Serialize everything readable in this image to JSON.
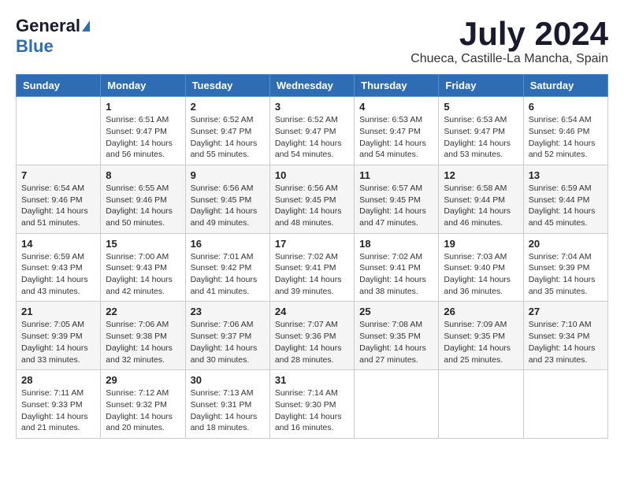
{
  "header": {
    "logo_general": "General",
    "logo_blue": "Blue",
    "month": "July 2024",
    "location": "Chueca, Castille-La Mancha, Spain"
  },
  "weekdays": [
    "Sunday",
    "Monday",
    "Tuesday",
    "Wednesday",
    "Thursday",
    "Friday",
    "Saturday"
  ],
  "weeks": [
    [
      {
        "day": "",
        "sunrise": "",
        "sunset": "",
        "daylight": ""
      },
      {
        "day": "1",
        "sunrise": "Sunrise: 6:51 AM",
        "sunset": "Sunset: 9:47 PM",
        "daylight": "Daylight: 14 hours and 56 minutes."
      },
      {
        "day": "2",
        "sunrise": "Sunrise: 6:52 AM",
        "sunset": "Sunset: 9:47 PM",
        "daylight": "Daylight: 14 hours and 55 minutes."
      },
      {
        "day": "3",
        "sunrise": "Sunrise: 6:52 AM",
        "sunset": "Sunset: 9:47 PM",
        "daylight": "Daylight: 14 hours and 54 minutes."
      },
      {
        "day": "4",
        "sunrise": "Sunrise: 6:53 AM",
        "sunset": "Sunset: 9:47 PM",
        "daylight": "Daylight: 14 hours and 54 minutes."
      },
      {
        "day": "5",
        "sunrise": "Sunrise: 6:53 AM",
        "sunset": "Sunset: 9:47 PM",
        "daylight": "Daylight: 14 hours and 53 minutes."
      },
      {
        "day": "6",
        "sunrise": "Sunrise: 6:54 AM",
        "sunset": "Sunset: 9:46 PM",
        "daylight": "Daylight: 14 hours and 52 minutes."
      }
    ],
    [
      {
        "day": "7",
        "sunrise": "Sunrise: 6:54 AM",
        "sunset": "Sunset: 9:46 PM",
        "daylight": "Daylight: 14 hours and 51 minutes."
      },
      {
        "day": "8",
        "sunrise": "Sunrise: 6:55 AM",
        "sunset": "Sunset: 9:46 PM",
        "daylight": "Daylight: 14 hours and 50 minutes."
      },
      {
        "day": "9",
        "sunrise": "Sunrise: 6:56 AM",
        "sunset": "Sunset: 9:45 PM",
        "daylight": "Daylight: 14 hours and 49 minutes."
      },
      {
        "day": "10",
        "sunrise": "Sunrise: 6:56 AM",
        "sunset": "Sunset: 9:45 PM",
        "daylight": "Daylight: 14 hours and 48 minutes."
      },
      {
        "day": "11",
        "sunrise": "Sunrise: 6:57 AM",
        "sunset": "Sunset: 9:45 PM",
        "daylight": "Daylight: 14 hours and 47 minutes."
      },
      {
        "day": "12",
        "sunrise": "Sunrise: 6:58 AM",
        "sunset": "Sunset: 9:44 PM",
        "daylight": "Daylight: 14 hours and 46 minutes."
      },
      {
        "day": "13",
        "sunrise": "Sunrise: 6:59 AM",
        "sunset": "Sunset: 9:44 PM",
        "daylight": "Daylight: 14 hours and 45 minutes."
      }
    ],
    [
      {
        "day": "14",
        "sunrise": "Sunrise: 6:59 AM",
        "sunset": "Sunset: 9:43 PM",
        "daylight": "Daylight: 14 hours and 43 minutes."
      },
      {
        "day": "15",
        "sunrise": "Sunrise: 7:00 AM",
        "sunset": "Sunset: 9:43 PM",
        "daylight": "Daylight: 14 hours and 42 minutes."
      },
      {
        "day": "16",
        "sunrise": "Sunrise: 7:01 AM",
        "sunset": "Sunset: 9:42 PM",
        "daylight": "Daylight: 14 hours and 41 minutes."
      },
      {
        "day": "17",
        "sunrise": "Sunrise: 7:02 AM",
        "sunset": "Sunset: 9:41 PM",
        "daylight": "Daylight: 14 hours and 39 minutes."
      },
      {
        "day": "18",
        "sunrise": "Sunrise: 7:02 AM",
        "sunset": "Sunset: 9:41 PM",
        "daylight": "Daylight: 14 hours and 38 minutes."
      },
      {
        "day": "19",
        "sunrise": "Sunrise: 7:03 AM",
        "sunset": "Sunset: 9:40 PM",
        "daylight": "Daylight: 14 hours and 36 minutes."
      },
      {
        "day": "20",
        "sunrise": "Sunrise: 7:04 AM",
        "sunset": "Sunset: 9:39 PM",
        "daylight": "Daylight: 14 hours and 35 minutes."
      }
    ],
    [
      {
        "day": "21",
        "sunrise": "Sunrise: 7:05 AM",
        "sunset": "Sunset: 9:39 PM",
        "daylight": "Daylight: 14 hours and 33 minutes."
      },
      {
        "day": "22",
        "sunrise": "Sunrise: 7:06 AM",
        "sunset": "Sunset: 9:38 PM",
        "daylight": "Daylight: 14 hours and 32 minutes."
      },
      {
        "day": "23",
        "sunrise": "Sunrise: 7:06 AM",
        "sunset": "Sunset: 9:37 PM",
        "daylight": "Daylight: 14 hours and 30 minutes."
      },
      {
        "day": "24",
        "sunrise": "Sunrise: 7:07 AM",
        "sunset": "Sunset: 9:36 PM",
        "daylight": "Daylight: 14 hours and 28 minutes."
      },
      {
        "day": "25",
        "sunrise": "Sunrise: 7:08 AM",
        "sunset": "Sunset: 9:35 PM",
        "daylight": "Daylight: 14 hours and 27 minutes."
      },
      {
        "day": "26",
        "sunrise": "Sunrise: 7:09 AM",
        "sunset": "Sunset: 9:35 PM",
        "daylight": "Daylight: 14 hours and 25 minutes."
      },
      {
        "day": "27",
        "sunrise": "Sunrise: 7:10 AM",
        "sunset": "Sunset: 9:34 PM",
        "daylight": "Daylight: 14 hours and 23 minutes."
      }
    ],
    [
      {
        "day": "28",
        "sunrise": "Sunrise: 7:11 AM",
        "sunset": "Sunset: 9:33 PM",
        "daylight": "Daylight: 14 hours and 21 minutes."
      },
      {
        "day": "29",
        "sunrise": "Sunrise: 7:12 AM",
        "sunset": "Sunset: 9:32 PM",
        "daylight": "Daylight: 14 hours and 20 minutes."
      },
      {
        "day": "30",
        "sunrise": "Sunrise: 7:13 AM",
        "sunset": "Sunset: 9:31 PM",
        "daylight": "Daylight: 14 hours and 18 minutes."
      },
      {
        "day": "31",
        "sunrise": "Sunrise: 7:14 AM",
        "sunset": "Sunset: 9:30 PM",
        "daylight": "Daylight: 14 hours and 16 minutes."
      },
      {
        "day": "",
        "sunrise": "",
        "sunset": "",
        "daylight": ""
      },
      {
        "day": "",
        "sunrise": "",
        "sunset": "",
        "daylight": ""
      },
      {
        "day": "",
        "sunrise": "",
        "sunset": "",
        "daylight": ""
      }
    ]
  ]
}
